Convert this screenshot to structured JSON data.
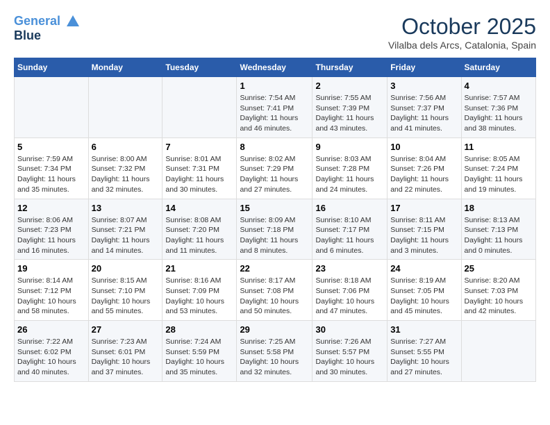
{
  "header": {
    "logo_line1": "General",
    "logo_line2": "Blue",
    "month": "October 2025",
    "location": "Vilalba dels Arcs, Catalonia, Spain"
  },
  "weekdays": [
    "Sunday",
    "Monday",
    "Tuesday",
    "Wednesday",
    "Thursday",
    "Friday",
    "Saturday"
  ],
  "weeks": [
    [
      {
        "day": "",
        "info": ""
      },
      {
        "day": "",
        "info": ""
      },
      {
        "day": "",
        "info": ""
      },
      {
        "day": "1",
        "info": "Sunrise: 7:54 AM\nSunset: 7:41 PM\nDaylight: 11 hours\nand 46 minutes."
      },
      {
        "day": "2",
        "info": "Sunrise: 7:55 AM\nSunset: 7:39 PM\nDaylight: 11 hours\nand 43 minutes."
      },
      {
        "day": "3",
        "info": "Sunrise: 7:56 AM\nSunset: 7:37 PM\nDaylight: 11 hours\nand 41 minutes."
      },
      {
        "day": "4",
        "info": "Sunrise: 7:57 AM\nSunset: 7:36 PM\nDaylight: 11 hours\nand 38 minutes."
      }
    ],
    [
      {
        "day": "5",
        "info": "Sunrise: 7:59 AM\nSunset: 7:34 PM\nDaylight: 11 hours\nand 35 minutes."
      },
      {
        "day": "6",
        "info": "Sunrise: 8:00 AM\nSunset: 7:32 PM\nDaylight: 11 hours\nand 32 minutes."
      },
      {
        "day": "7",
        "info": "Sunrise: 8:01 AM\nSunset: 7:31 PM\nDaylight: 11 hours\nand 30 minutes."
      },
      {
        "day": "8",
        "info": "Sunrise: 8:02 AM\nSunset: 7:29 PM\nDaylight: 11 hours\nand 27 minutes."
      },
      {
        "day": "9",
        "info": "Sunrise: 8:03 AM\nSunset: 7:28 PM\nDaylight: 11 hours\nand 24 minutes."
      },
      {
        "day": "10",
        "info": "Sunrise: 8:04 AM\nSunset: 7:26 PM\nDaylight: 11 hours\nand 22 minutes."
      },
      {
        "day": "11",
        "info": "Sunrise: 8:05 AM\nSunset: 7:24 PM\nDaylight: 11 hours\nand 19 minutes."
      }
    ],
    [
      {
        "day": "12",
        "info": "Sunrise: 8:06 AM\nSunset: 7:23 PM\nDaylight: 11 hours\nand 16 minutes."
      },
      {
        "day": "13",
        "info": "Sunrise: 8:07 AM\nSunset: 7:21 PM\nDaylight: 11 hours\nand 14 minutes."
      },
      {
        "day": "14",
        "info": "Sunrise: 8:08 AM\nSunset: 7:20 PM\nDaylight: 11 hours\nand 11 minutes."
      },
      {
        "day": "15",
        "info": "Sunrise: 8:09 AM\nSunset: 7:18 PM\nDaylight: 11 hours\nand 8 minutes."
      },
      {
        "day": "16",
        "info": "Sunrise: 8:10 AM\nSunset: 7:17 PM\nDaylight: 11 hours\nand 6 minutes."
      },
      {
        "day": "17",
        "info": "Sunrise: 8:11 AM\nSunset: 7:15 PM\nDaylight: 11 hours\nand 3 minutes."
      },
      {
        "day": "18",
        "info": "Sunrise: 8:13 AM\nSunset: 7:13 PM\nDaylight: 11 hours\nand 0 minutes."
      }
    ],
    [
      {
        "day": "19",
        "info": "Sunrise: 8:14 AM\nSunset: 7:12 PM\nDaylight: 10 hours\nand 58 minutes."
      },
      {
        "day": "20",
        "info": "Sunrise: 8:15 AM\nSunset: 7:10 PM\nDaylight: 10 hours\nand 55 minutes."
      },
      {
        "day": "21",
        "info": "Sunrise: 8:16 AM\nSunset: 7:09 PM\nDaylight: 10 hours\nand 53 minutes."
      },
      {
        "day": "22",
        "info": "Sunrise: 8:17 AM\nSunset: 7:08 PM\nDaylight: 10 hours\nand 50 minutes."
      },
      {
        "day": "23",
        "info": "Sunrise: 8:18 AM\nSunset: 7:06 PM\nDaylight: 10 hours\nand 47 minutes."
      },
      {
        "day": "24",
        "info": "Sunrise: 8:19 AM\nSunset: 7:05 PM\nDaylight: 10 hours\nand 45 minutes."
      },
      {
        "day": "25",
        "info": "Sunrise: 8:20 AM\nSunset: 7:03 PM\nDaylight: 10 hours\nand 42 minutes."
      }
    ],
    [
      {
        "day": "26",
        "info": "Sunrise: 7:22 AM\nSunset: 6:02 PM\nDaylight: 10 hours\nand 40 minutes."
      },
      {
        "day": "27",
        "info": "Sunrise: 7:23 AM\nSunset: 6:01 PM\nDaylight: 10 hours\nand 37 minutes."
      },
      {
        "day": "28",
        "info": "Sunrise: 7:24 AM\nSunset: 5:59 PM\nDaylight: 10 hours\nand 35 minutes."
      },
      {
        "day": "29",
        "info": "Sunrise: 7:25 AM\nSunset: 5:58 PM\nDaylight: 10 hours\nand 32 minutes."
      },
      {
        "day": "30",
        "info": "Sunrise: 7:26 AM\nSunset: 5:57 PM\nDaylight: 10 hours\nand 30 minutes."
      },
      {
        "day": "31",
        "info": "Sunrise: 7:27 AM\nSunset: 5:55 PM\nDaylight: 10 hours\nand 27 minutes."
      },
      {
        "day": "",
        "info": ""
      }
    ]
  ]
}
